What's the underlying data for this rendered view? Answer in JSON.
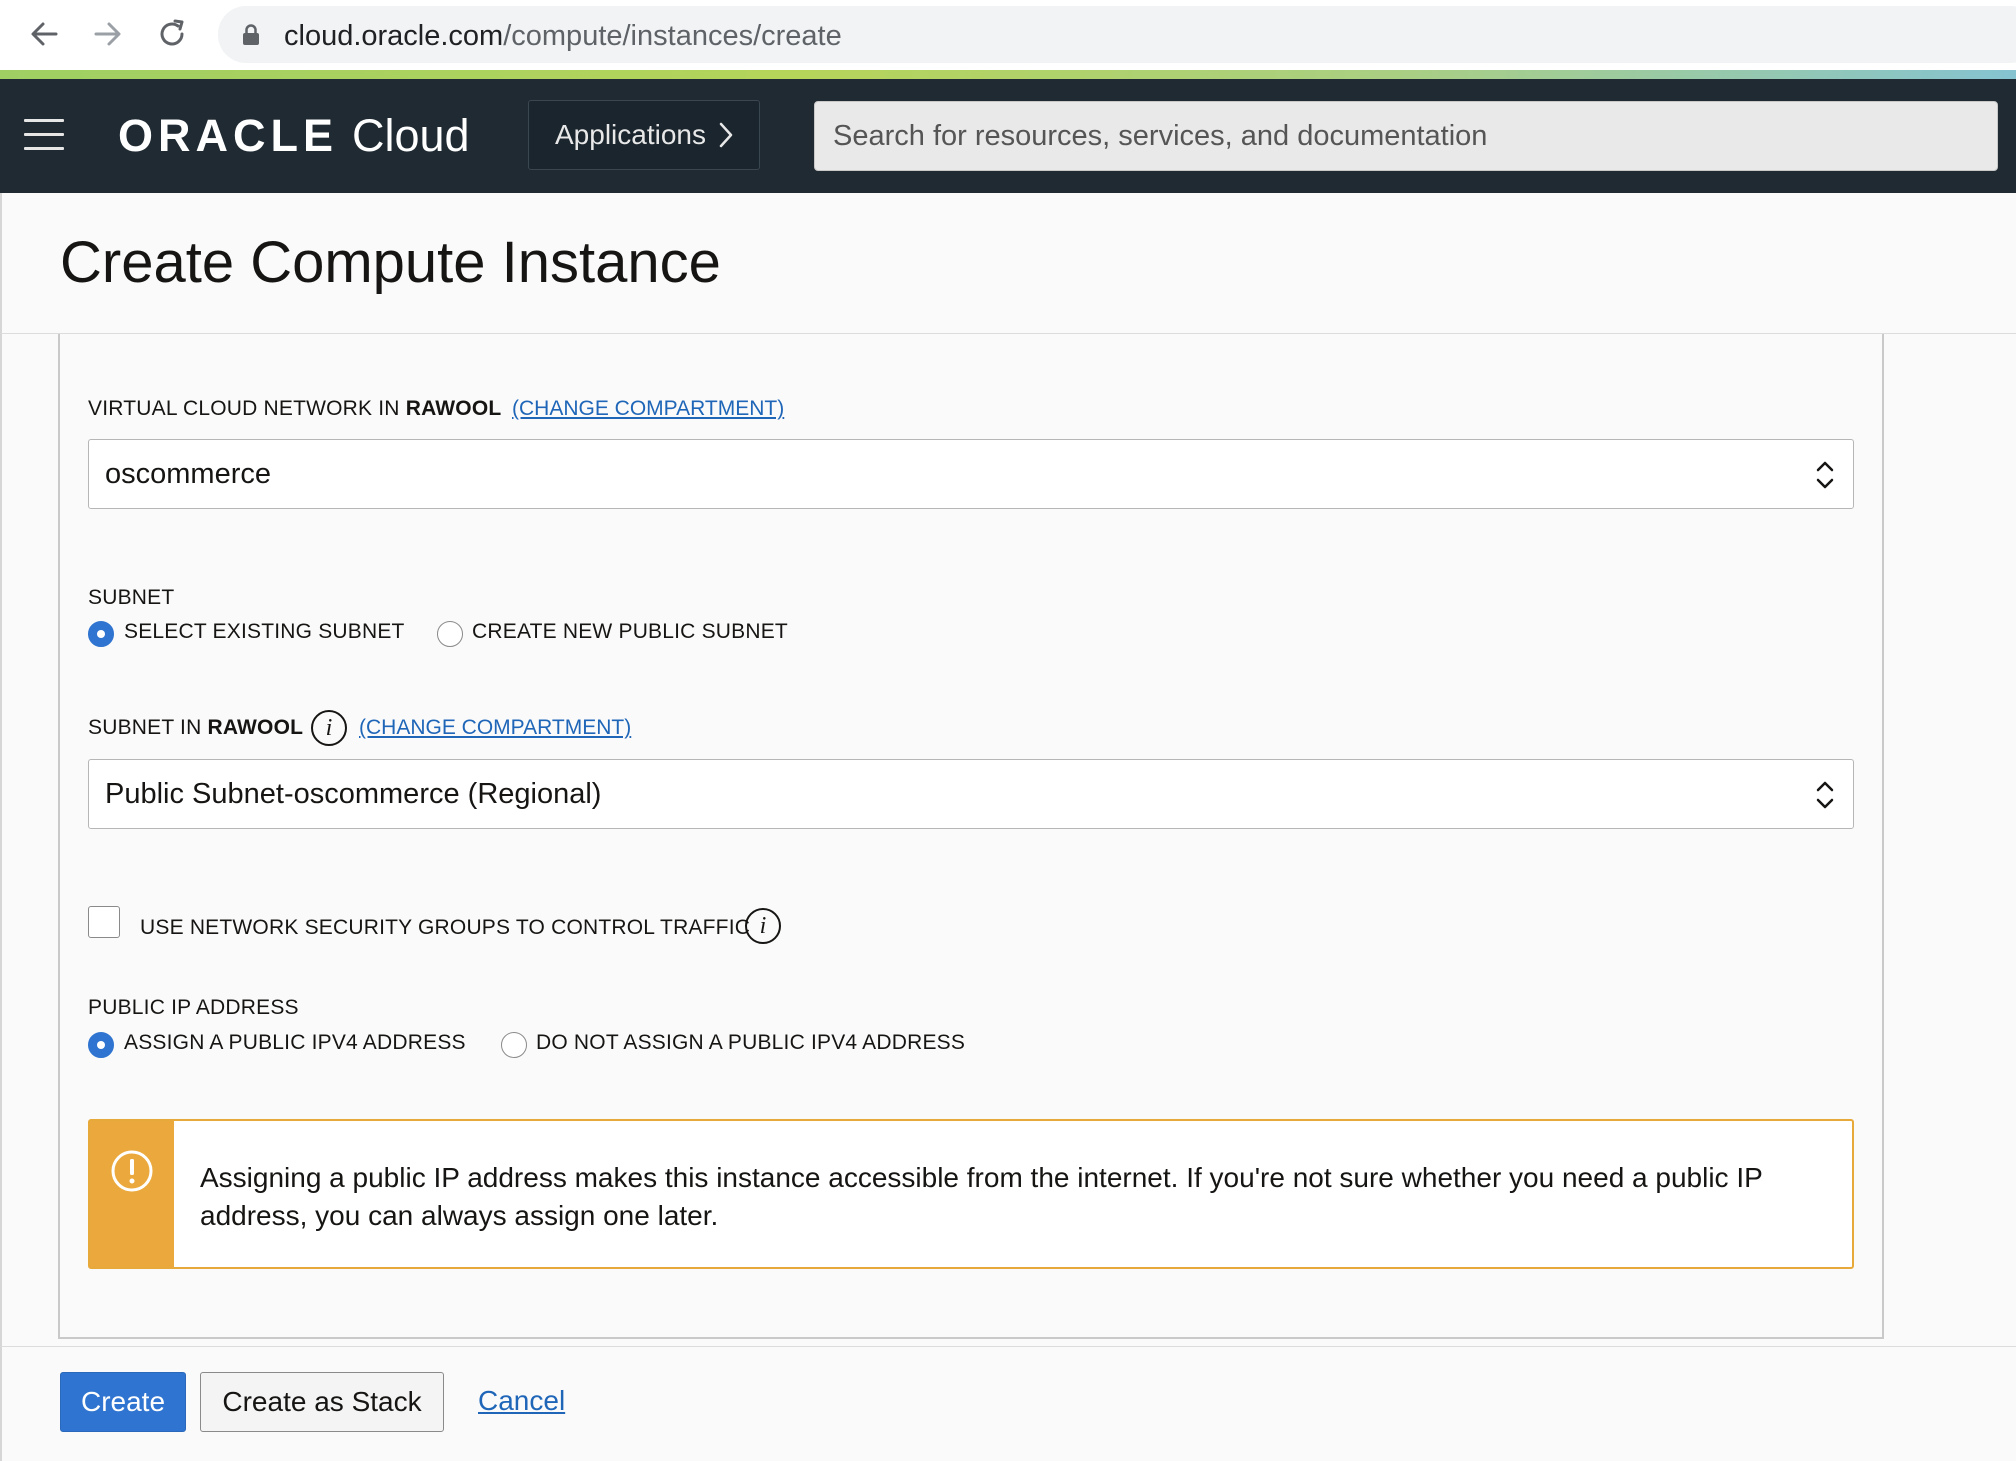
{
  "browser": {
    "url_host": "cloud.oracle.com",
    "url_path": "/compute/instances/create"
  },
  "header": {
    "brand_oracle": "ORACLE",
    "brand_cloud": "Cloud",
    "applications_label": "Applications",
    "search_placeholder": "Search for resources, services, and documentation"
  },
  "page": {
    "title": "Create Compute Instance"
  },
  "form": {
    "vcn": {
      "label_prefix": "VIRTUAL CLOUD NETWORK IN ",
      "label_compartment": "RAWOOL",
      "change_link": "(CHANGE COMPARTMENT)",
      "selected": "oscommerce"
    },
    "subnet": {
      "label": "SUBNET",
      "options": [
        {
          "label": "SELECT EXISTING SUBNET",
          "selected": true
        },
        {
          "label": "CREATE NEW PUBLIC SUBNET",
          "selected": false
        }
      ]
    },
    "subnet_in": {
      "label_prefix": "SUBNET IN ",
      "label_compartment": "RAWOOL",
      "change_link": "(CHANGE COMPARTMENT)",
      "selected": "Public Subnet-oscommerce (Regional)"
    },
    "nsg": {
      "label": "USE NETWORK SECURITY GROUPS TO CONTROL TRAFFIC",
      "checked": false
    },
    "public_ip": {
      "label": "PUBLIC IP ADDRESS",
      "options": [
        {
          "label": "ASSIGN A PUBLIC IPV4 ADDRESS",
          "selected": true
        },
        {
          "label": "DO NOT ASSIGN A PUBLIC IPV4 ADDRESS",
          "selected": false
        }
      ]
    },
    "warning": {
      "text": "Assigning a public IP address makes this instance accessible from the internet. If you're not sure whether you need a public IP address, you can always assign one later."
    }
  },
  "footer": {
    "create_label": "Create",
    "stack_label": "Create as Stack",
    "cancel_label": "Cancel"
  },
  "colors": {
    "header_bg": "#1f2a33",
    "primary": "#2f74d0",
    "link": "#1f66b8",
    "warning": "#eba93d"
  }
}
